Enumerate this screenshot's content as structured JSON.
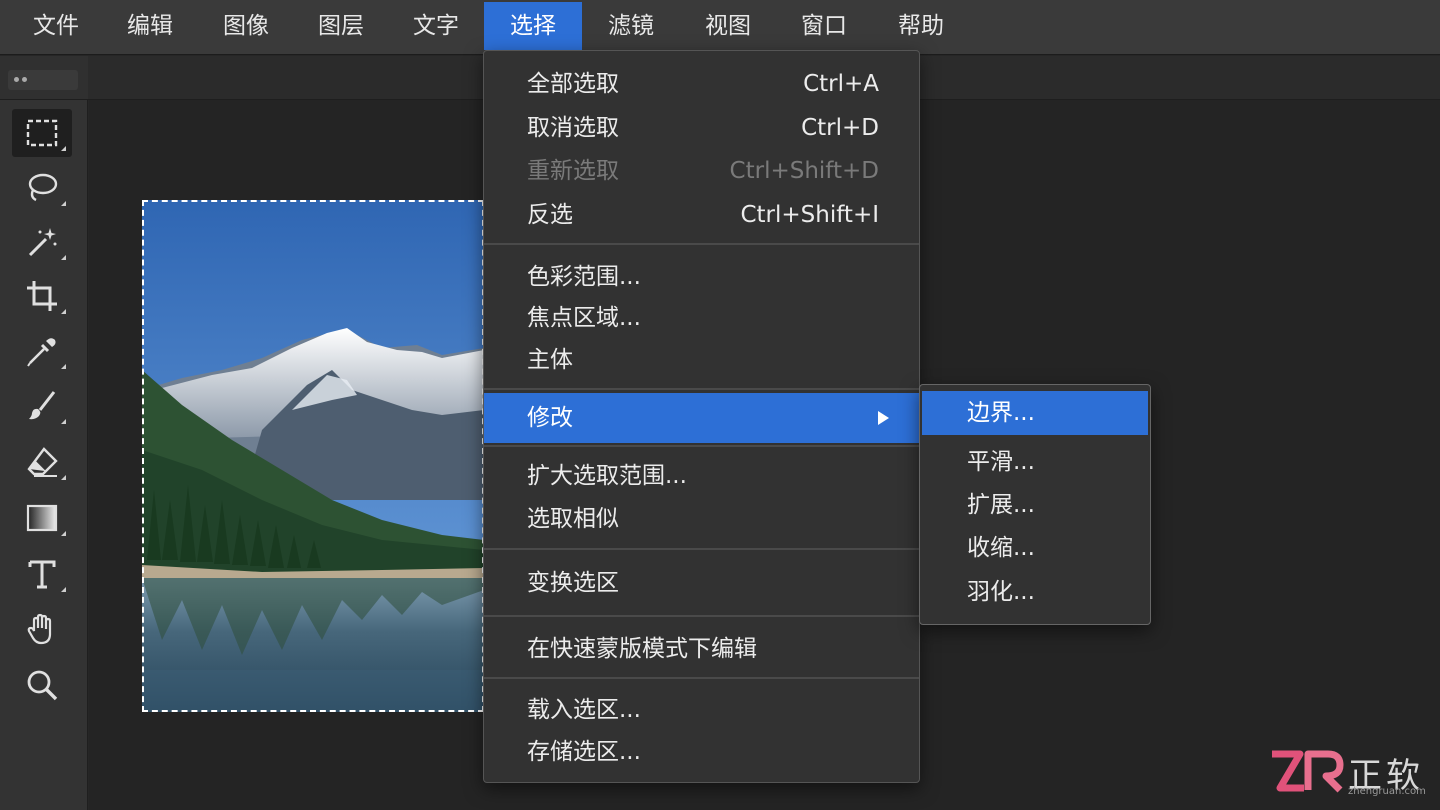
{
  "menubar": {
    "items": [
      {
        "label": "文件"
      },
      {
        "label": "编辑"
      },
      {
        "label": "图像"
      },
      {
        "label": "图层"
      },
      {
        "label": "文字"
      },
      {
        "label": "选择",
        "active": true
      },
      {
        "label": "滤镜"
      },
      {
        "label": "视图"
      },
      {
        "label": "窗口"
      },
      {
        "label": "帮助"
      }
    ]
  },
  "toolbar": {
    "tools": [
      {
        "icon": "rectangular-marquee-icon",
        "active": true
      },
      {
        "icon": "lasso-icon"
      },
      {
        "icon": "magic-wand-icon"
      },
      {
        "icon": "crop-icon"
      },
      {
        "icon": "eyedropper-icon"
      },
      {
        "icon": "brush-icon"
      },
      {
        "icon": "eraser-icon"
      },
      {
        "icon": "gradient-icon"
      },
      {
        "icon": "type-icon"
      },
      {
        "icon": "hand-icon"
      },
      {
        "icon": "zoom-icon"
      }
    ]
  },
  "select_menu": {
    "items": [
      {
        "label": "全部选取",
        "shortcut": "Ctrl+A"
      },
      {
        "label": "取消选取",
        "shortcut": "Ctrl+D"
      },
      {
        "label": "重新选取",
        "shortcut": "Ctrl+Shift+D",
        "disabled": true
      },
      {
        "label": "反选",
        "shortcut": "Ctrl+Shift+I"
      },
      {
        "label": "色彩范围..."
      },
      {
        "label": "焦点区域..."
      },
      {
        "label": "主体"
      },
      {
        "label": "修改",
        "submenu": true,
        "highlighted": true
      },
      {
        "label": "扩大选取范围..."
      },
      {
        "label": "选取相似"
      },
      {
        "label": "变换选区"
      },
      {
        "label": "在快速蒙版模式下编辑"
      },
      {
        "label": "载入选区..."
      },
      {
        "label": "存储选区..."
      }
    ]
  },
  "modify_submenu": {
    "items": [
      {
        "label": "边界...",
        "highlighted": true
      },
      {
        "label": "平滑..."
      },
      {
        "label": "扩展..."
      },
      {
        "label": "收缩..."
      },
      {
        "label": "羽化..."
      }
    ]
  },
  "watermark": {
    "logo": "ZR",
    "brand": "正软",
    "site": "zhengruan.com"
  },
  "colors": {
    "accent": "#2d6fd6",
    "menubar": "#3a3a3a",
    "panel": "#323232",
    "canvas": "#242424"
  }
}
